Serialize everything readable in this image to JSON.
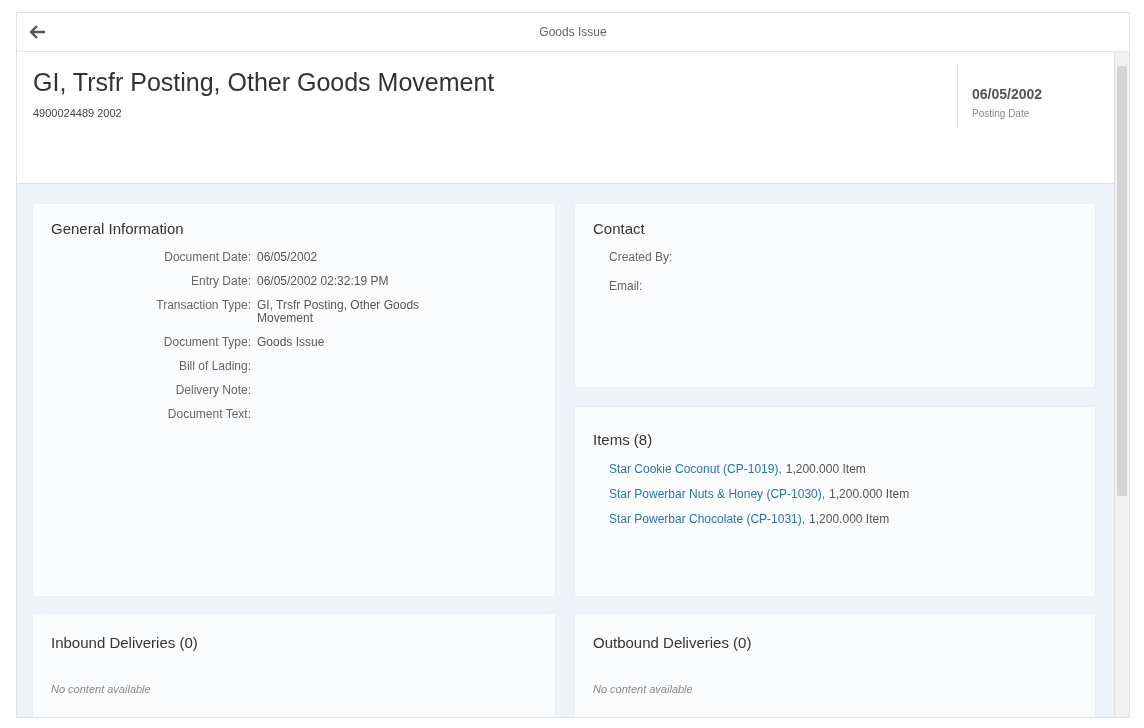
{
  "window": {
    "title": "Goods Issue"
  },
  "object_header": {
    "title": "GI, Trsfr Posting, Other Goods Movement",
    "subtitle": "4900024489 2002",
    "attribute": {
      "value": "06/05/2002",
      "label": "Posting Date"
    }
  },
  "general_information": {
    "title": "General Information",
    "fields": [
      {
        "label": "Document Date:",
        "value": "06/05/2002"
      },
      {
        "label": "Entry Date:",
        "value": "06/05/2002 02:32:19 PM"
      },
      {
        "label": "Transaction Type:",
        "value": "GI, Trsfr Posting, Other Goods Movement"
      },
      {
        "label": "Document Type:",
        "value": "Goods Issue"
      },
      {
        "label": "Bill of Lading:"
      },
      {
        "label": "Delivery Note:"
      },
      {
        "label": "Document Text:"
      }
    ]
  },
  "contact": {
    "title": "Contact",
    "fields": [
      {
        "label": "Created By:"
      },
      {
        "label": "Email:"
      }
    ]
  },
  "items": {
    "title": "Items (8)",
    "rows": [
      {
        "name": "Star Cookie Coconut (CP-1019),",
        "quantity": "1,200.000 Item"
      },
      {
        "name": "Star Powerbar Nuts & Honey (CP-1030),",
        "quantity": "1,200.000 Item"
      },
      {
        "name": "Star Powerbar Chocolate (CP-1031),",
        "quantity": "1,200.000 Item"
      }
    ]
  },
  "inbound_deliveries": {
    "title": "Inbound Deliveries (0)",
    "empty_text": "No content available"
  },
  "outbound_deliveries": {
    "title": "Outbound Deliveries (0)",
    "empty_text": "No content available"
  }
}
